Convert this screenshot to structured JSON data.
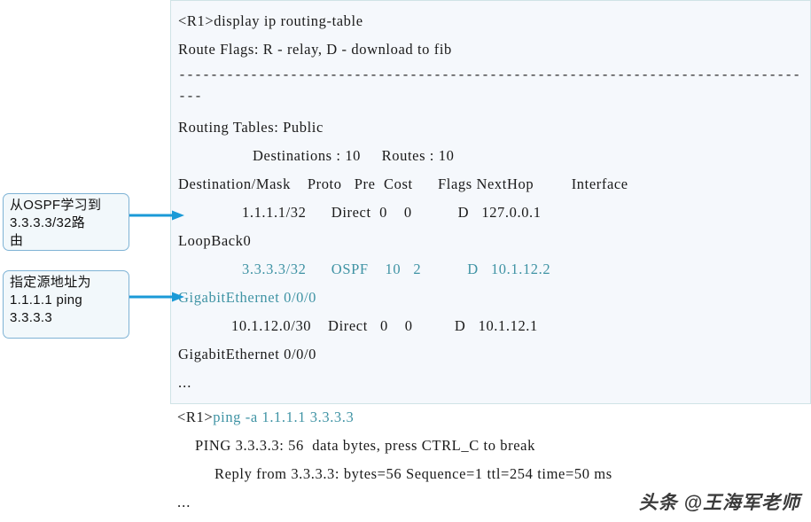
{
  "colors": {
    "page_background": "#ffffff",
    "console_background": "#f5f8fc",
    "console_border": "#cfe3e6",
    "text": "#1a1a1a",
    "highlight_teal": "#3f93a4",
    "callout_fill": "#f2f8fb",
    "callout_border": "#7fb3d5",
    "arrow": "#1a9ad7"
  },
  "console": {
    "routing_table": {
      "lines": [
        {
          "id": "cmd-display-route",
          "segments": [
            {
              "text": "<R1>display ip routing-table",
              "color": "dark"
            }
          ],
          "indent": 0
        },
        {
          "id": "route-flags",
          "segments": [
            {
              "text": "Route Flags: R - relay, D - download to fib",
              "color": "dark"
            }
          ],
          "indent": 0
        },
        {
          "id": "separator-rule",
          "segments": [
            {
              "text": "------------------------------------------------------------------------------",
              "color": "dark"
            }
          ],
          "indent": 0,
          "style": "dash-rule"
        },
        {
          "id": "separator-rule-wrap",
          "segments": [
            {
              "text": "---",
              "color": "dark"
            }
          ],
          "indent": 0,
          "style": "dash-rule"
        },
        {
          "id": "routing-tables-public",
          "segments": [
            {
              "text": "Routing Tables: Public",
              "color": "dark"
            }
          ],
          "indent": 0
        },
        {
          "id": "counts",
          "segments": [
            {
              "text": "Destinations : 10     Routes : 10",
              "color": "dark"
            }
          ],
          "indent": 84
        },
        {
          "id": "column-headers",
          "segments": [
            {
              "text": "Destination/Mask    Proto   Pre  Cost      Flags NextHop         Interface",
              "color": "dark"
            }
          ],
          "indent": 0
        },
        {
          "id": "route-loopback",
          "segments": [
            {
              "text": "1.1.1.1/32      Direct  0    0           D   127.0.0.1",
              "color": "dark"
            }
          ],
          "indent": 72
        },
        {
          "id": "route-loopback-iface",
          "segments": [
            {
              "text": "LoopBack0",
              "color": "dark"
            }
          ],
          "indent": 0
        },
        {
          "id": "route-ospf",
          "segments": [
            {
              "text": "3.3.3.3/32      OSPF    10   2           D   10.1.12.2",
              "color": "teal"
            }
          ],
          "indent": 72
        },
        {
          "id": "route-ospf-iface",
          "segments": [
            {
              "text": "GigabitEthernet 0/0/0",
              "color": "teal"
            }
          ],
          "indent": 0
        },
        {
          "id": "route-connected",
          "segments": [
            {
              "text": "10.1.12.0/30    Direct   0    0          D   10.1.12.1",
              "color": "dark"
            }
          ],
          "indent": 60
        },
        {
          "id": "route-connected-iface",
          "segments": [
            {
              "text": "GigabitEthernet 0/0/0",
              "color": "dark"
            }
          ],
          "indent": 0
        },
        {
          "id": "routing-ellipsis",
          "segments": [
            {
              "text": "...",
              "color": "dark"
            }
          ],
          "indent": 0,
          "style": "ellipsis"
        }
      ]
    },
    "ping_output": {
      "lines": [
        {
          "id": "cmd-ping",
          "segments": [
            {
              "text": "<R1>",
              "color": "dark"
            },
            {
              "text": "ping -a 1.1.1.1 3.3.3.3",
              "color": "teal"
            }
          ],
          "indent": 0
        },
        {
          "id": "ping-banner",
          "segments": [
            {
              "text": "PING 3.3.3.3: 56  data bytes, press CTRL_C to break",
              "color": "dark"
            }
          ],
          "indent": 20
        },
        {
          "id": "ping-reply-1",
          "segments": [
            {
              "text": "Reply from 3.3.3.3: bytes=56 Sequence=1 ttl=254 time=50 ms",
              "color": "dark"
            }
          ],
          "indent": 42
        },
        {
          "id": "ping-ellipsis",
          "segments": [
            {
              "text": "...",
              "color": "dark"
            }
          ],
          "indent": 0,
          "style": "ellipsis"
        }
      ]
    }
  },
  "callouts": [
    {
      "id": "callout-ospf",
      "text": "从OSPF学习到\n3.3.3.3/32路\n由"
    },
    {
      "id": "callout-ping",
      "text": "指定源地址为\n1.1.1.1 ping\n3.3.3.3"
    }
  ],
  "watermark": {
    "text": "头条 @王海军老师"
  }
}
